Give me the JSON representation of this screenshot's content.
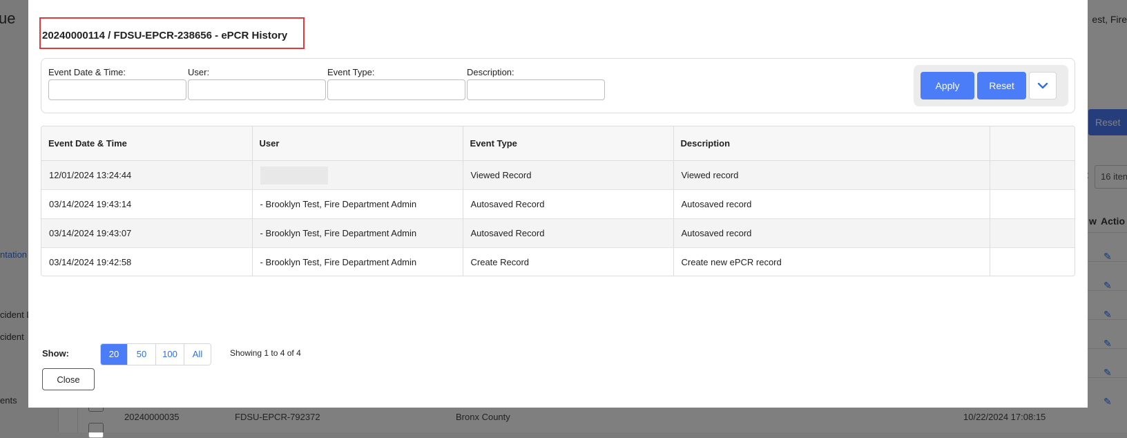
{
  "background": {
    "brand_fragment": "ue",
    "user_fragment": "est, Fire",
    "sidebar_links": [
      "ntation",
      "cident L",
      "cident",
      "ents"
    ],
    "reset_label": "Reset",
    "items_label": ":",
    "items_value": "16 iten",
    "col_view": "w",
    "col_action": "Actio",
    "bottom_row": {
      "num": "20240000035",
      "epcr": "FDSU-EPCR-792372",
      "county": "Bronx County",
      "date": "10/22/2024 17:08:15"
    }
  },
  "modal": {
    "title": "20240000114 / FDSU-EPCR-238656 - ePCR History",
    "filters": [
      {
        "label": "Event Date & Time:",
        "value": ""
      },
      {
        "label": "User:",
        "value": ""
      },
      {
        "label": "Event Type:",
        "value": ""
      },
      {
        "label": "Description:",
        "value": ""
      }
    ],
    "apply_label": "Apply",
    "reset_label": "Reset",
    "table": {
      "columns": [
        "Event Date & Time",
        "User",
        "Event Type",
        "Description",
        ""
      ],
      "rows": [
        [
          "12/01/2024 13:24:44",
          "",
          "Viewed Record",
          "Viewed record",
          ""
        ],
        [
          "03/14/2024 19:43:14",
          "- Brooklyn Test, Fire Department Admin",
          "Autosaved Record",
          "Autosaved record",
          ""
        ],
        [
          "03/14/2024 19:43:07",
          "- Brooklyn Test, Fire Department Admin",
          "Autosaved Record",
          "Autosaved record",
          ""
        ],
        [
          "03/14/2024 19:42:58",
          "- Brooklyn Test, Fire Department Admin",
          "Create Record",
          "Create new ePCR record",
          ""
        ]
      ]
    },
    "show_label": "Show:",
    "page_sizes": [
      "20",
      "50",
      "100",
      "All"
    ],
    "selected_page_size": "20",
    "showing_text": "Showing 1 to 4 of 4",
    "close_label": "Close"
  },
  "colors": {
    "accent": "#4a7df7",
    "highlight_border": "#e0393e"
  },
  "icons": {
    "date_picker": "calendar-icon",
    "expand": "chevron-down-icon",
    "edit": "pencil-icon"
  }
}
